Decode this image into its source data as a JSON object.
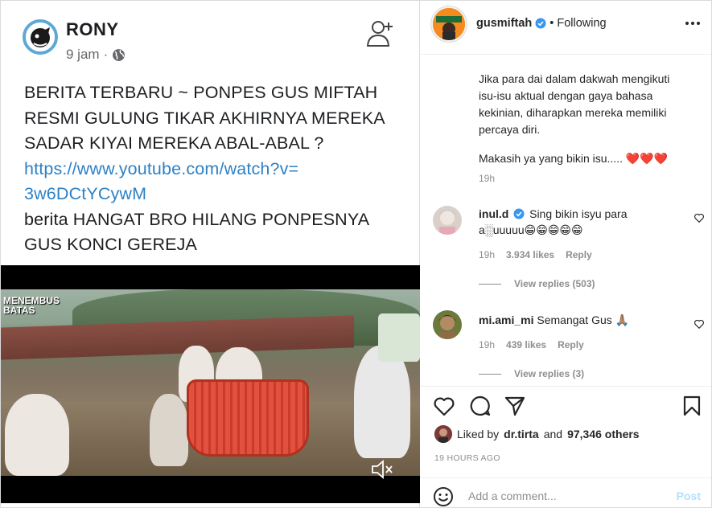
{
  "facebook_post": {
    "author": "RONY",
    "time": "9 jam",
    "separator": "·",
    "text_line_1": "BERITA TERBARU ~ PONPES GUS MIFTAH",
    "text_line_2": "RESMI GULUNG TIKAR AKHIRNYA MEREKA",
    "text_line_3": "SADAR KIYAI MEREKA ABAL-ABAL ?",
    "link_line_1": "https://www.youtube.com/watch?v=",
    "link_line_2": "3w6DCtYCywM",
    "text_line_4": "berita HANGAT BRO HILANG PONPESNYA",
    "text_line_5": "GUS KONCI GEREJA",
    "video_logo_1": "MENEMBUS",
    "video_logo_2": "BATAS",
    "icons": [
      "add-friend-icon",
      "globe-icon",
      "mute-icon"
    ]
  },
  "instagram": {
    "username": "gusmiftah",
    "separator": "•",
    "follow_status": "Following",
    "caption_line_1": "Jika para dai dalam dakwah mengikuti",
    "caption_line_2": "isu-isu aktual dengan gaya bahasa",
    "caption_line_3": "kekinian, diharapkan mereka memiliki",
    "caption_line_4": "percaya diri.",
    "caption_line_5": "Makasih ya yang bikin isu..... ❤️❤️❤️",
    "caption_time": "19h",
    "comments": [
      {
        "user": "inul.d",
        "text_1": "Sing bikin isyu para",
        "text_2": "a░uuuuu😁😁😁😁😁",
        "time": "19h",
        "likes": "3.934 likes",
        "reply": "Reply",
        "view_replies": "View replies (503)"
      },
      {
        "user": "mi.ami_mi",
        "text_1": "Semangat Gus 🙏🏽",
        "time": "19h",
        "likes": "439 likes",
        "reply": "Reply",
        "view_replies": "View replies (3)"
      }
    ],
    "liked_by_prefix": "Liked by",
    "liked_by_user": "dr.tirta",
    "liked_by_and": "and",
    "liked_by_others": "97,346 others",
    "post_time": "19 HOURS AGO",
    "comment_placeholder": "Add a comment...",
    "post_button": "Post",
    "colors": {
      "link": "#2e81c4",
      "verified": "#3897f0",
      "muted": "#8e8e8e",
      "post_button": "#b2dffc"
    },
    "icons": [
      "more-icon",
      "heart-icon",
      "comment-icon",
      "share-icon",
      "bookmark-icon",
      "emoji-icon",
      "verified-icon"
    ]
  }
}
